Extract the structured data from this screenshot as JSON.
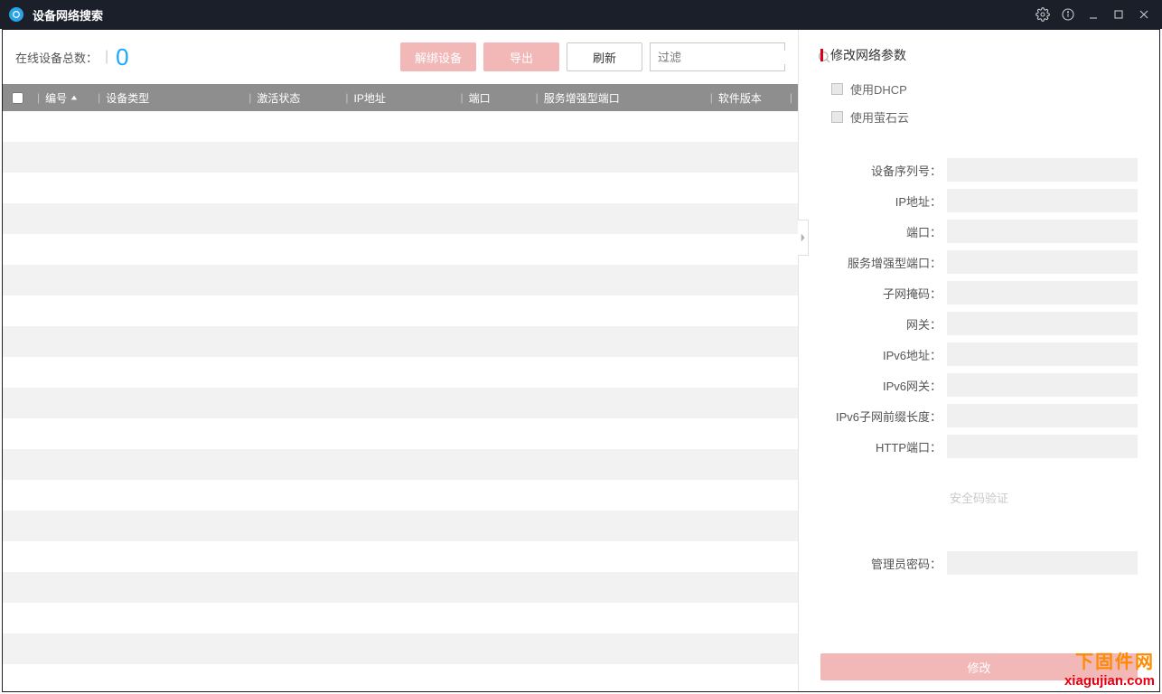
{
  "titlebar": {
    "title": "设备网络搜索"
  },
  "toolbar": {
    "online_label": "在线设备总数：",
    "online_count": "0",
    "unbind_label": "解绑设备",
    "export_label": "导出",
    "refresh_label": "刷新",
    "filter_placeholder": "过滤"
  },
  "columns": {
    "num": "编号",
    "type": "设备类型",
    "activate": "激活状态",
    "ip": "IP地址",
    "port": "端口",
    "enhanced": "服务增强型端口",
    "version": "软件版本"
  },
  "panel": {
    "title": "修改网络参数",
    "use_dhcp": "使用DHCP",
    "use_ezviz": "使用萤石云",
    "fields": {
      "serial": "设备序列号：",
      "ip": "IP地址：",
      "port": "端口：",
      "enhanced": "服务增强型端口：",
      "mask": "子网掩码：",
      "gateway": "网关：",
      "ipv6": "IPv6地址：",
      "ipv6gw": "IPv6网关：",
      "ipv6prefix": "IPv6子网前缀长度：",
      "http": "HTTP端口："
    },
    "security_title": "安全码验证",
    "admin_pwd": "管理员密码：",
    "modify": "修改"
  },
  "watermark": {
    "line1": "下固件网",
    "line2": "xiagujian.com"
  }
}
